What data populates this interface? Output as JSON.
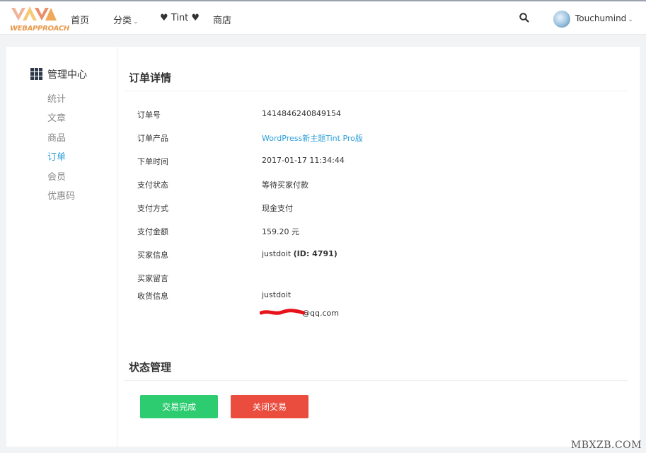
{
  "header": {
    "logo_text": "WEBAPPROACH",
    "nav": [
      {
        "label": "首页"
      },
      {
        "label": "分类",
        "has_dropdown": true
      },
      {
        "label": "♥ Tint ♥"
      },
      {
        "label": "商店"
      }
    ],
    "user_name": "Touchumind"
  },
  "sidebar": {
    "title": "管理中心",
    "items": [
      {
        "label": "统计",
        "active": false
      },
      {
        "label": "文章",
        "active": false
      },
      {
        "label": "商品",
        "active": false
      },
      {
        "label": "订单",
        "active": true
      },
      {
        "label": "会员",
        "active": false
      },
      {
        "label": "优惠码",
        "active": false
      }
    ]
  },
  "order": {
    "section_title": "订单详情",
    "rows": [
      {
        "label": "订单号",
        "value": "1414846240849154"
      },
      {
        "label": "订单产品",
        "value": "WordPress新主题Tint Pro版",
        "is_link": true
      },
      {
        "label": "下单时间",
        "value": "2017-01-17 11:34:44"
      },
      {
        "label": "支付状态",
        "value": "等待买家付款"
      },
      {
        "label": "支付方式",
        "value": "现金支付"
      },
      {
        "label": "支付金额",
        "value": "159.20 元"
      },
      {
        "label": "买家信息",
        "value": "justdoit",
        "value_bold": "(ID: 4791)"
      },
      {
        "label": "买家留言",
        "value": ""
      },
      {
        "label": "收货信息",
        "value": "justdoit"
      }
    ],
    "email_visible_part": "@qq.com"
  },
  "status": {
    "section_title": "状态管理",
    "complete_label": "交易完成",
    "close_label": "关闭交易"
  },
  "watermark": "MBXZB.COM",
  "colors": {
    "accent": "#2e9fd8",
    "complete_button": "#2ecc71",
    "close_button": "#ea4c3d",
    "redaction": "#e8121b"
  },
  "icons": {
    "search": "search-icon",
    "grid": "grid-icon",
    "chevron": "chevron-down-icon"
  }
}
